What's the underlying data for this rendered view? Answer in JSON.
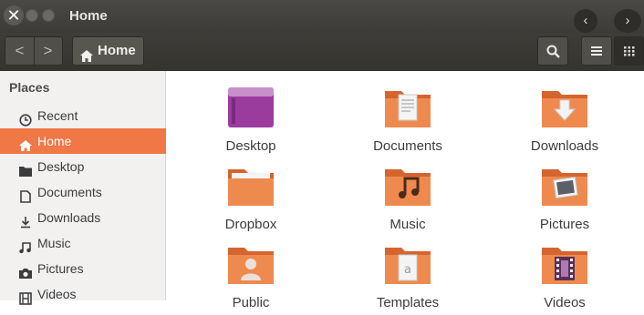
{
  "window": {
    "title": "Home",
    "close_glyph": "✕",
    "back_glyph": "‹",
    "forward_glyph": "›"
  },
  "toolbar": {
    "back_glyph": "<",
    "forward_glyph": ">",
    "location": "Home",
    "location_icon": "home-icon",
    "search_icon": "search-icon",
    "list_view_icon": "list-view-icon",
    "grid_view_icon": "grid-view-icon"
  },
  "sidebar": {
    "heading": "Places",
    "items": [
      {
        "label": "Recent",
        "icon": "clock-icon",
        "active": false
      },
      {
        "label": "Home",
        "icon": "home-icon",
        "active": true
      },
      {
        "label": "Desktop",
        "icon": "folder-icon",
        "active": false
      },
      {
        "label": "Documents",
        "icon": "document-icon",
        "active": false
      },
      {
        "label": "Downloads",
        "icon": "download-icon",
        "active": false
      },
      {
        "label": "Music",
        "icon": "music-icon",
        "active": false
      },
      {
        "label": "Pictures",
        "icon": "camera-icon",
        "active": false
      },
      {
        "label": "Videos",
        "icon": "film-icon",
        "active": false
      }
    ]
  },
  "files": [
    {
      "name": "Desktop",
      "icon": "desktop-folder-icon"
    },
    {
      "name": "Documents",
      "icon": "documents-folder-icon"
    },
    {
      "name": "Downloads",
      "icon": "downloads-folder-icon"
    },
    {
      "name": "Dropbox",
      "icon": "folder-icon"
    },
    {
      "name": "Music",
      "icon": "music-folder-icon"
    },
    {
      "name": "Pictures",
      "icon": "pictures-folder-icon"
    },
    {
      "name": "Public",
      "icon": "public-folder-icon"
    },
    {
      "name": "Templates",
      "icon": "templates-folder-icon"
    },
    {
      "name": "Videos",
      "icon": "videos-folder-icon"
    }
  ],
  "colors": {
    "accent": "#f07746",
    "folder": "#e8743b",
    "desktop_folder": "#9b3b9e",
    "titlebar": "#3c3b37"
  }
}
